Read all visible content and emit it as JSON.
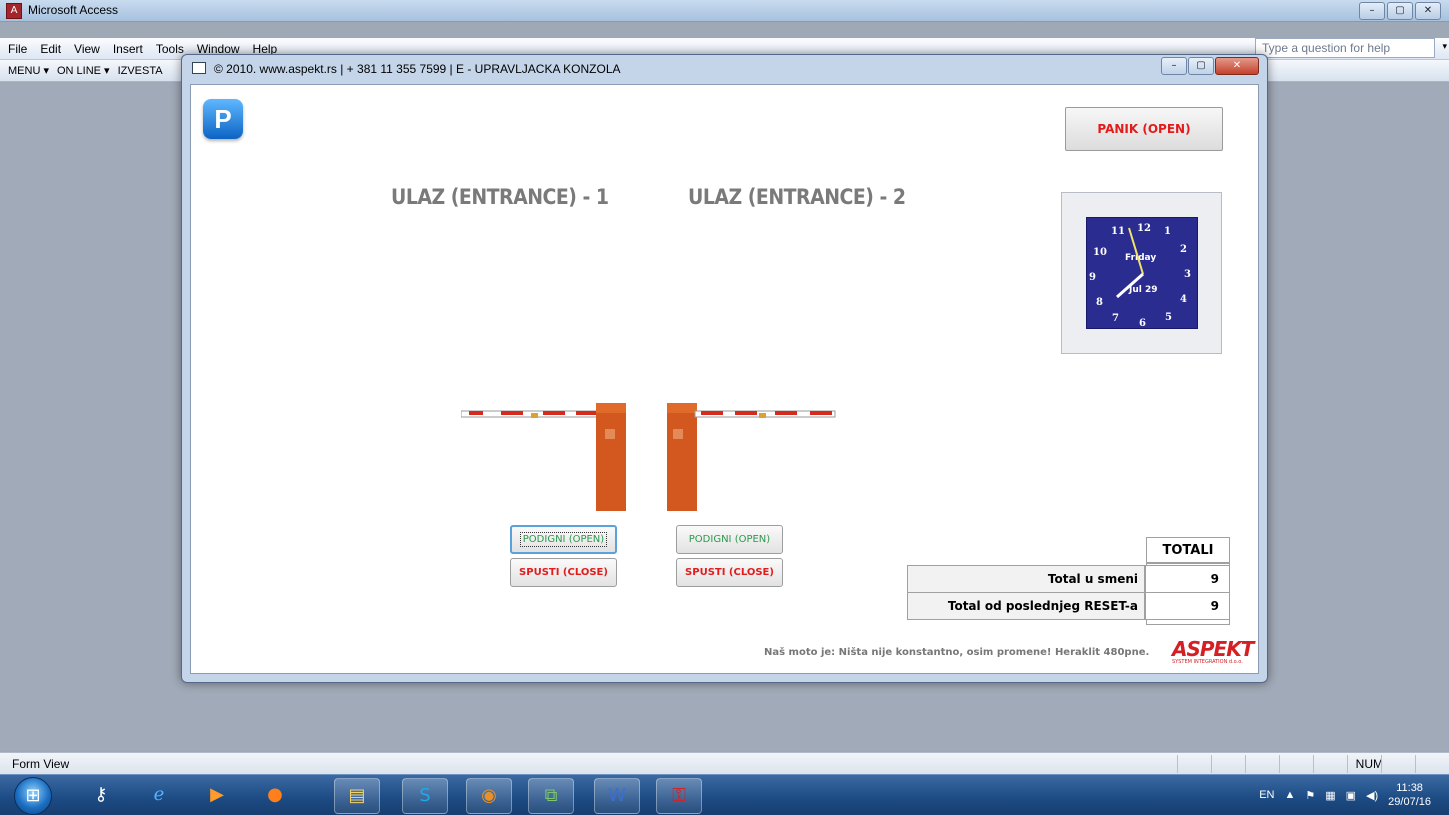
{
  "app": {
    "title": "Microsoft Access",
    "window_controls": [
      "–",
      "▢",
      "✕"
    ]
  },
  "menu": {
    "items": [
      "File",
      "Edit",
      "View",
      "Insert",
      "Tools",
      "Window",
      "Help"
    ],
    "help_placeholder": "Type a question for help"
  },
  "toolbar": {
    "items": [
      "MENU ▾",
      "ON LINE ▾",
      "IZVESTA"
    ]
  },
  "form": {
    "title": "© 2010. www.aspekt.rs | + 381 11 355 7599 | E - UPRAVLJACKA KONZOLA",
    "logo_letter": "P",
    "panic_label": "PANIK (OPEN)",
    "entrance_1": "ULAZ (ENTRANCE) - 1",
    "entrance_2": "ULAZ (ENTRANCE) - 2",
    "clock": {
      "day": "Friday",
      "date": "Jul 29",
      "numbers": [
        "12",
        "1",
        "2",
        "3",
        "4",
        "5",
        "6",
        "7",
        "8",
        "9",
        "10",
        "11"
      ]
    },
    "gate1": {
      "open_label": "PODIGNI (OPEN)",
      "close_label": "SPUSTI (CLOSE)"
    },
    "gate2": {
      "open_label": "PODIGNI (OPEN)",
      "close_label": "SPUSTI (CLOSE)"
    },
    "totals": {
      "header": "TOTALI",
      "rows": [
        {
          "label": "Total u smeni",
          "value": "9"
        },
        {
          "label": "Total od poslednjeg RESET-a",
          "value": "9"
        }
      ]
    },
    "motto": "Naš moto je: Ništa nije konstantno, osim promene! Heraklit 480pne.",
    "brand": "ASPEKT",
    "brand_sub": "SYSTEM INTEGRATION d.o.o."
  },
  "status": {
    "left": "Form View",
    "num": "NUM"
  },
  "taskbar": {
    "lang": "EN",
    "time": "11:38",
    "date": "29/07/16"
  },
  "colors": {
    "panic_text": "#e31b1b",
    "open_text": "#2a9a4a",
    "close_text": "#e21c1c",
    "clock_face": "#2a2c8f",
    "barrier_post": "#d2581f",
    "brand": "#d41f24"
  }
}
